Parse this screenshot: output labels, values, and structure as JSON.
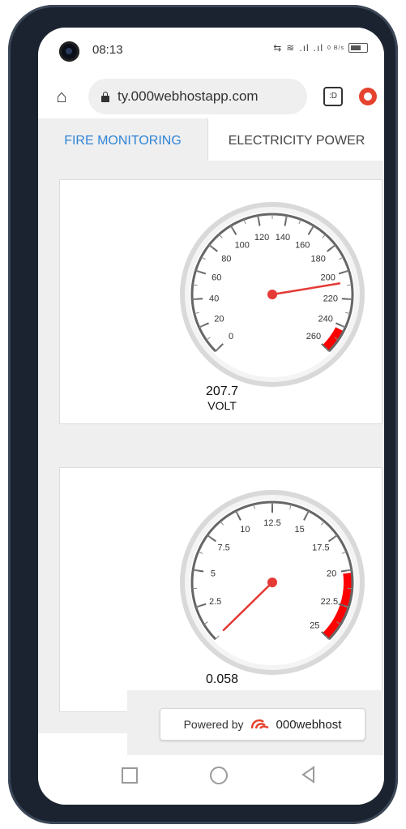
{
  "status_bar": {
    "time": "08:13",
    "icons": [
      "vibrate-icon",
      "wifi-icon",
      "signal-icon",
      "signal-icon",
      "data-speed-icon",
      "battery-icon"
    ],
    "data_speed": "0 B/s"
  },
  "browser": {
    "url": "ty.000webhostapp.com",
    "tab_count": ":D"
  },
  "tabs": [
    {
      "label": "FIRE MONITORING",
      "active": true
    },
    {
      "label": "ELECTRICITY POWER",
      "active": false
    }
  ],
  "gauges": [
    {
      "value": "207.7",
      "unit": "VOLT",
      "min": 0,
      "max": 260,
      "reading": 207.7,
      "ticks": [
        "0",
        "20",
        "40",
        "60",
        "80",
        "100",
        "120",
        "140",
        "160",
        "180",
        "200",
        "220",
        "240",
        "260"
      ],
      "red_from": 240,
      "red_to": 260
    },
    {
      "value": "0.058",
      "unit": "",
      "min": 0,
      "max": 25,
      "reading": 0.058,
      "ticks": [
        "2.5",
        "5",
        "7.5",
        "10",
        "12.5",
        "15",
        "17.5",
        "20",
        "22.5",
        "25"
      ],
      "red_from": 20,
      "red_to": 25
    }
  ],
  "footer": {
    "powered_by": "Powered by",
    "brand": "000webhost"
  },
  "colors": {
    "accent": "#2f84d6",
    "needle": "#e53935",
    "red_zone": "#ff0000",
    "menu": "#e5432f"
  }
}
